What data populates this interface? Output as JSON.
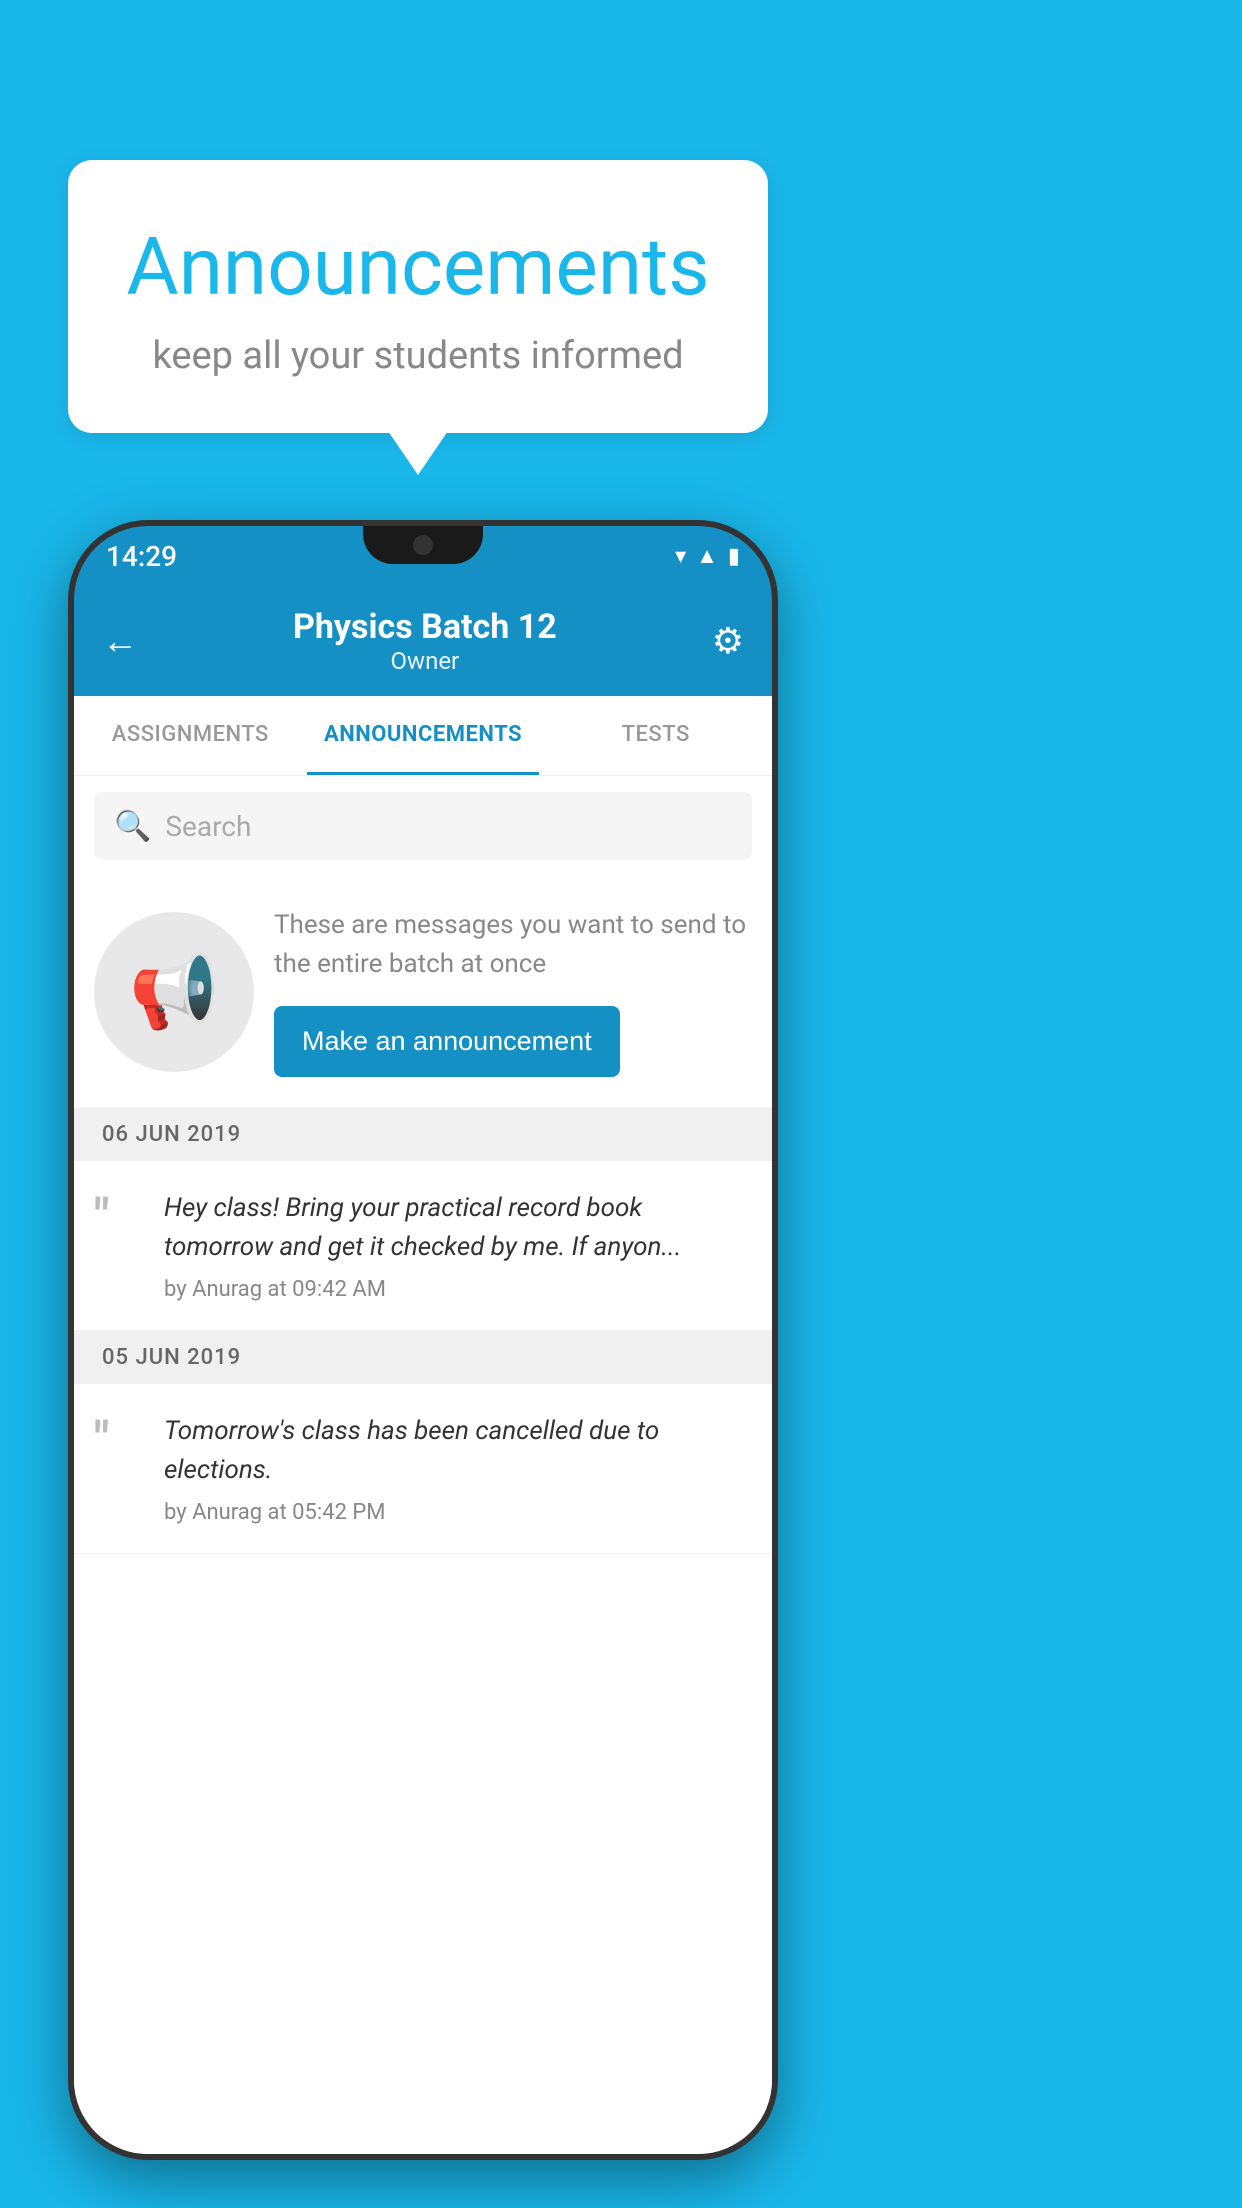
{
  "background_color": "#1ab7ea",
  "speech_bubble": {
    "title": "Announcements",
    "subtitle": "keep all your students informed"
  },
  "phone": {
    "status_bar": {
      "time": "14:29",
      "wifi_icon": "▾",
      "signal_icon": "▲",
      "battery_icon": "▮"
    },
    "header": {
      "back_label": "←",
      "title": "Physics Batch 12",
      "subtitle": "Owner",
      "gear_icon": "⚙"
    },
    "tabs": [
      {
        "label": "ASSIGNMENTS",
        "active": false
      },
      {
        "label": "ANNOUNCEMENTS",
        "active": true
      },
      {
        "label": "TESTS",
        "active": false
      }
    ],
    "search": {
      "placeholder": "Search"
    },
    "promo": {
      "text": "These are messages you want to send to the entire batch at once",
      "button_label": "Make an announcement"
    },
    "announcements": [
      {
        "date": "06  JUN  2019",
        "text": "Hey class! Bring your practical record book tomorrow and get it checked by me. If anyon...",
        "meta": "by Anurag at 09:42 AM"
      },
      {
        "date": "05  JUN  2019",
        "text": "Tomorrow's class has been cancelled due to elections.",
        "meta": "by Anurag at 05:42 PM"
      }
    ]
  }
}
